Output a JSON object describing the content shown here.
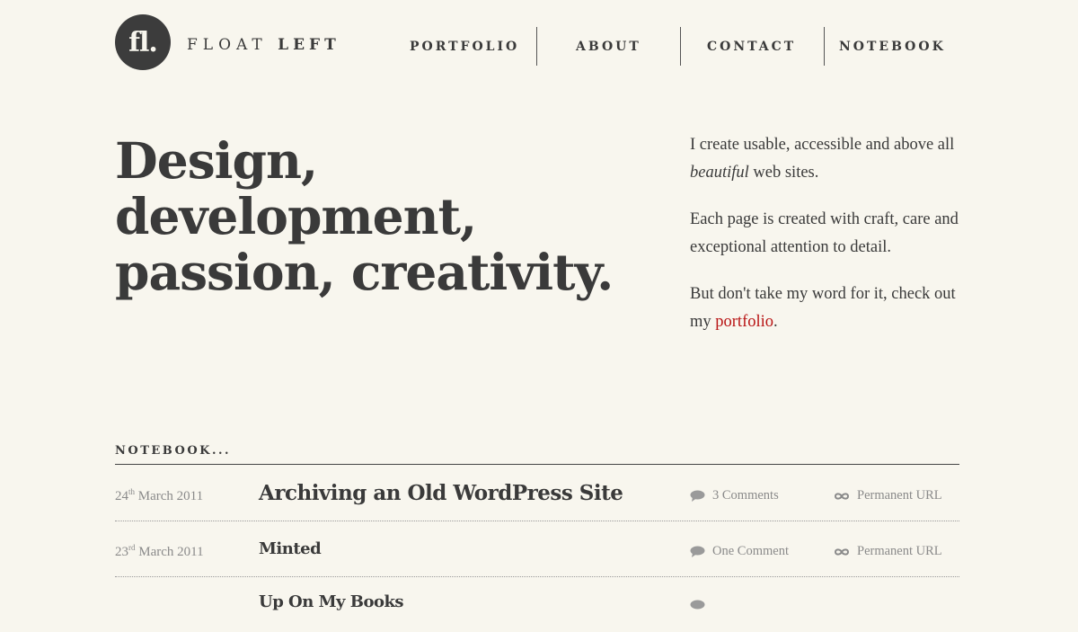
{
  "header": {
    "logo_mark": "fl.",
    "logo_word1": "FLOAT",
    "logo_word2": "LEFT",
    "nav": [
      {
        "label": "PORTFOLIO"
      },
      {
        "label": "ABOUT"
      },
      {
        "label": "CONTACT"
      },
      {
        "label": "NOTEBOOK"
      }
    ]
  },
  "hero": {
    "lines": [
      "Design,",
      "development,",
      "passion, creativity."
    ]
  },
  "intro": {
    "p1_a": "I create usable, accessible and above all ",
    "p1_em": "beautiful",
    "p1_b": " web sites.",
    "p2": "Each page is created with craft, care and exceptional attention to detail.",
    "p3_a": "But don't take my word for it, check out my ",
    "p3_link": "portfolio",
    "p3_b": "."
  },
  "colors": {
    "background": "#f8f6ee",
    "text": "#3a3a3a",
    "link": "#b81414",
    "muted": "#8a8a8a"
  },
  "notebook": {
    "heading": "NOTEBOOK...",
    "posts": [
      {
        "day": "24",
        "suffix": "th",
        "month_year": "March 2011",
        "title": "Archiving an Old WordPress Site",
        "comments": "3 Comments",
        "permalink": "Permanent URL"
      },
      {
        "day": "23",
        "suffix": "rd",
        "month_year": "March 2011",
        "title": "Minted",
        "comments": "One Comment",
        "permalink": "Permanent URL"
      },
      {
        "day": "",
        "suffix": "",
        "month_year": "",
        "title": "Up On My Books",
        "comments": "",
        "permalink": ""
      }
    ]
  }
}
